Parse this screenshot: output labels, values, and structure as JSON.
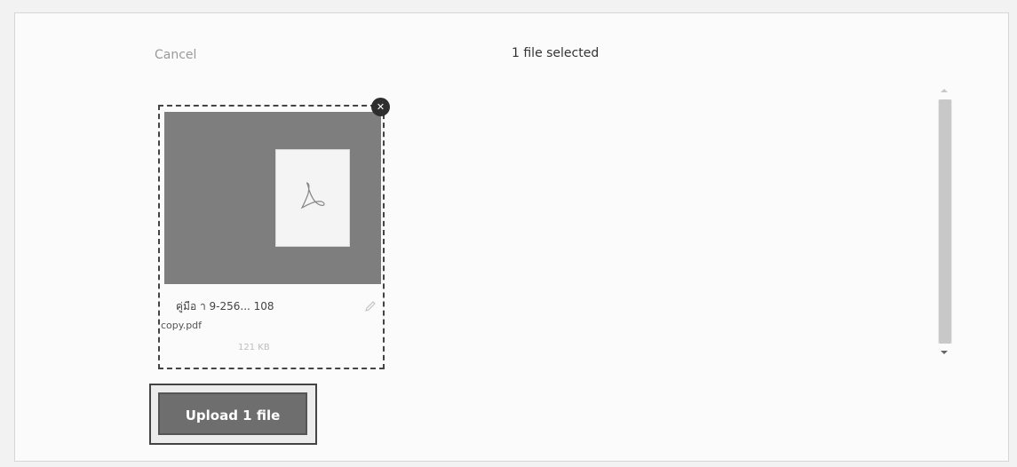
{
  "header": {
    "cancel_label": "Cancel",
    "title": "1 file selected"
  },
  "file": {
    "name_line1": "คู่มือ า 9-256... 108",
    "name_line2": "copy.pdf",
    "size": "121 KB",
    "thumbnail_icon": "pdf-icon",
    "remove_icon": "close-icon",
    "rename_icon": "pencil-icon"
  },
  "footer": {
    "upload_label": "Upload 1 file"
  },
  "colors": {
    "thumbnail_bg": "#7e7e7e",
    "button_bg": "#6e6e6e",
    "remove_bg": "#2e2e2e"
  }
}
